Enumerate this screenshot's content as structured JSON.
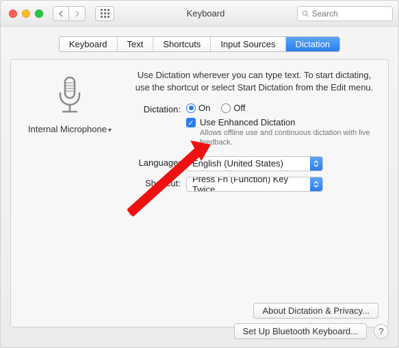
{
  "window": {
    "title": "Keyboard"
  },
  "search": {
    "placeholder": "Search"
  },
  "tabs": [
    "Keyboard",
    "Text",
    "Shortcuts",
    "Input Sources",
    "Dictation"
  ],
  "active_tab_index": 4,
  "sidebar": {
    "device_label": "Internal Microphone"
  },
  "intro": "Use Dictation wherever you can type text. To start dictating, use the shortcut or select Start Dictation from the Edit menu.",
  "dictation": {
    "label": "Dictation:",
    "on_label": "On",
    "off_label": "Off",
    "selected": "on",
    "enhanced_label": "Use Enhanced Dictation",
    "enhanced_checked": true,
    "enhanced_help": "Allows offline use and continuous dictation with live feedback."
  },
  "language": {
    "label": "Language:",
    "value": "English (United States)"
  },
  "shortcut": {
    "label": "Shortcut:",
    "value": "Press Fn (Function) Key Twice"
  },
  "buttons": {
    "about": "About Dictation & Privacy...",
    "bluetooth": "Set Up Bluetooth Keyboard...",
    "help": "?"
  }
}
